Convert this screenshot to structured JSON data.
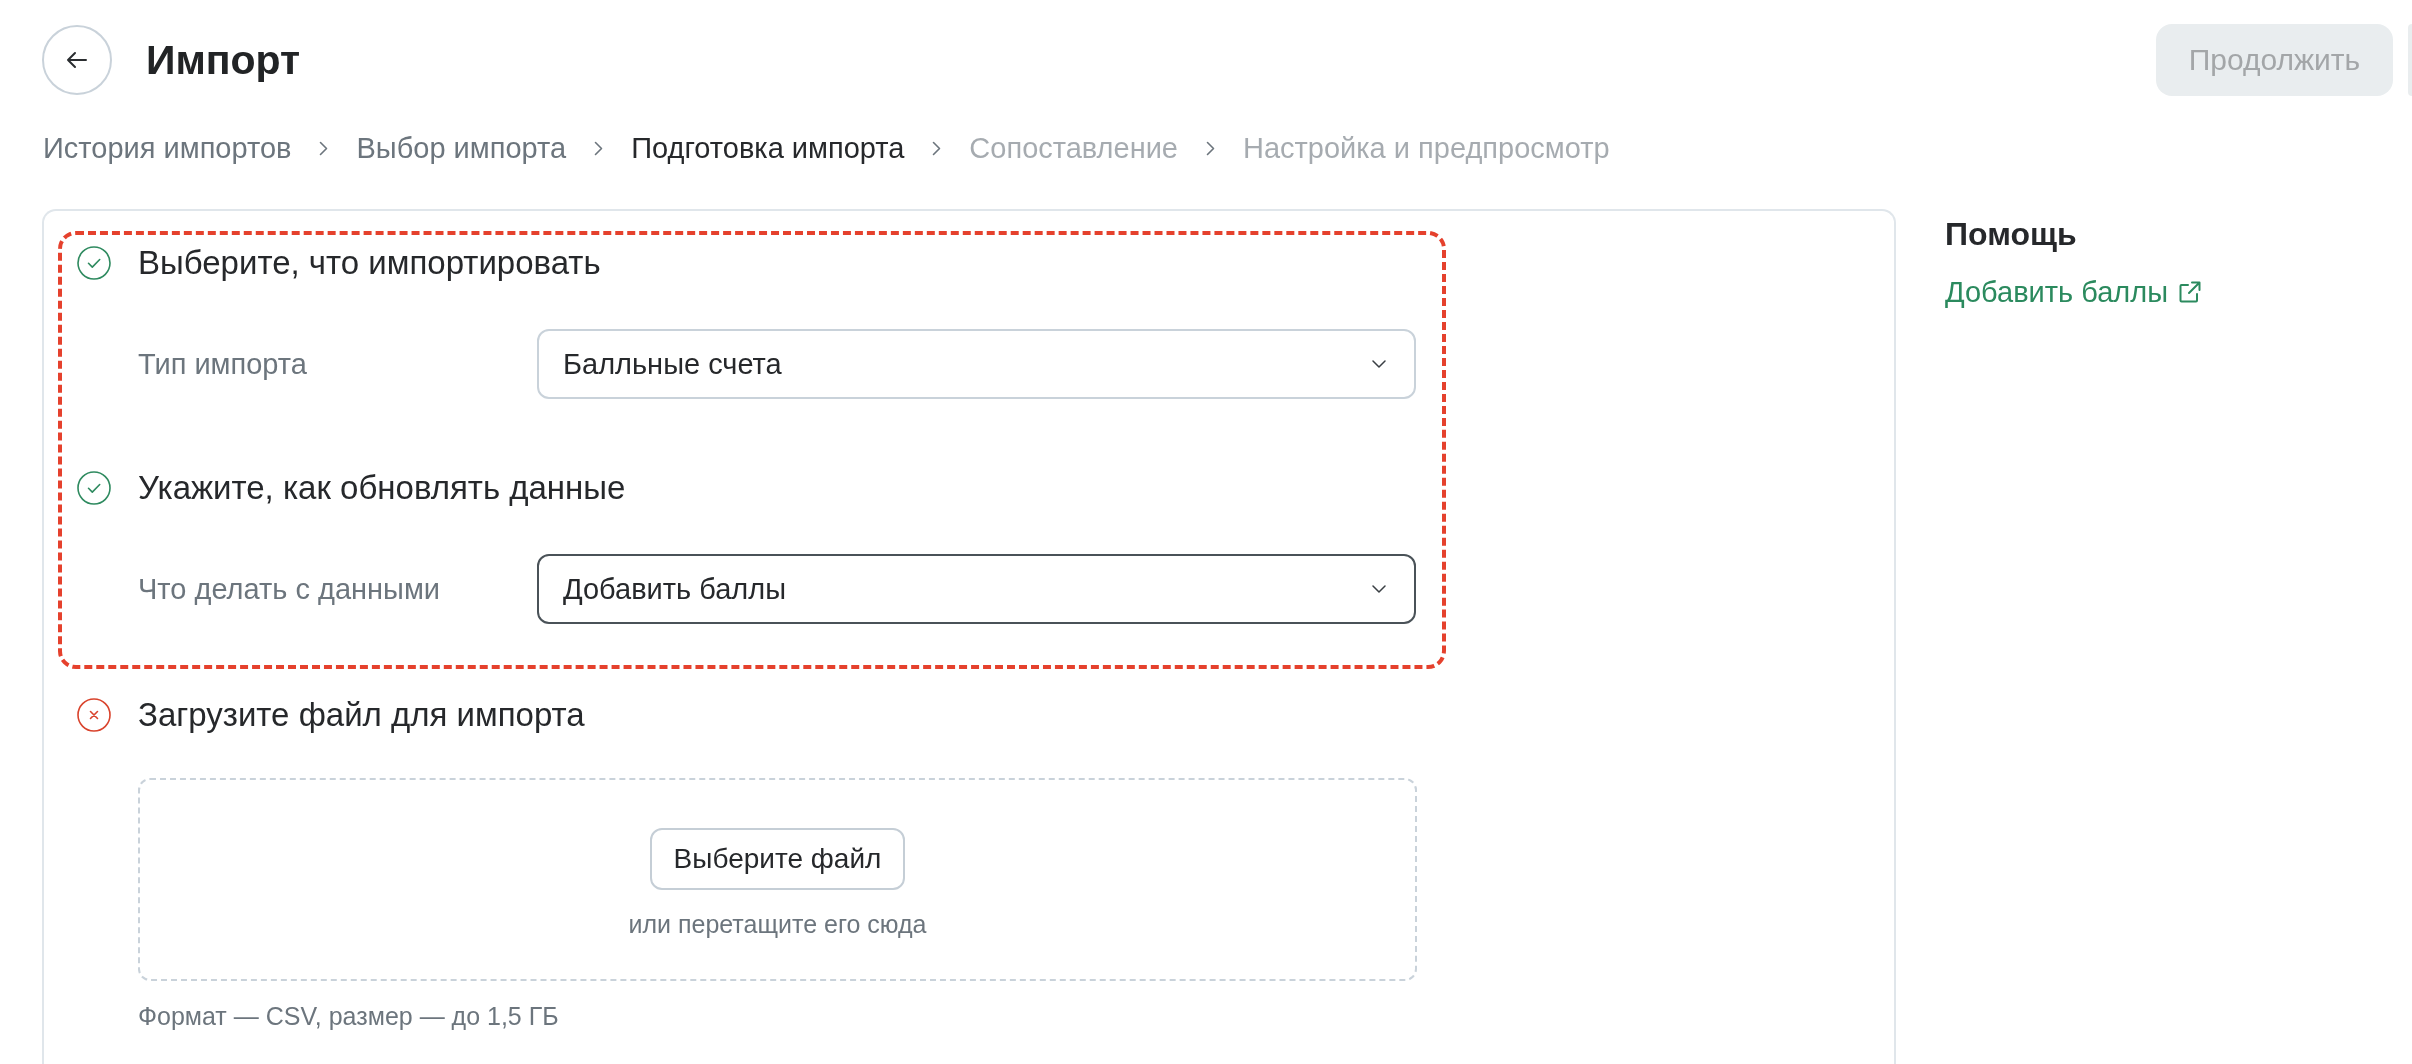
{
  "header": {
    "title": "Импорт",
    "continue_button": {
      "label": "Продолжить",
      "disabled": true
    }
  },
  "breadcrumbs": [
    {
      "label": "История импортов",
      "selected": false,
      "disabled": false
    },
    {
      "label": "Выбор импорта",
      "selected": false,
      "disabled": false
    },
    {
      "label": "Подготовка импорта",
      "selected": true,
      "disabled": false
    },
    {
      "label": "Сопоставление",
      "selected": false,
      "disabled": true
    },
    {
      "label": "Настройка и предпросмотр",
      "selected": false,
      "disabled": true
    }
  ],
  "steps": [
    {
      "title": "Выберите, что импортировать",
      "completed": true,
      "highlighted": true,
      "field": {
        "label": "Тип импорта",
        "value": "Балльные счета",
        "focused": false
      }
    },
    {
      "title": "Укажите, как обновлять данные",
      "completed": true,
      "highlighted": true,
      "field": {
        "label": "Что делать с данными",
        "value": "Добавить баллы",
        "focused": true
      }
    },
    {
      "title": "Загрузите файл для импорта",
      "completed": false,
      "highlighted": false,
      "upload": {
        "button": "Выберите файл",
        "hint": "или перетащите его сюда",
        "note": "Формат — CSV, размер — до 1,5 ГБ"
      }
    }
  ],
  "help": {
    "title": "Помощь",
    "links": [
      {
        "label": "Добавить баллы"
      }
    ]
  }
}
